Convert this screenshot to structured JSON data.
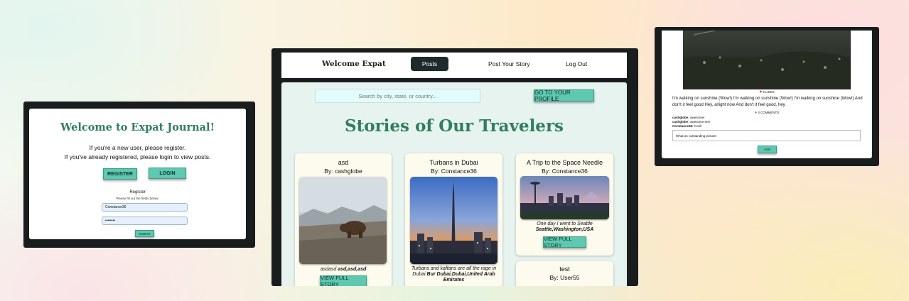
{
  "login": {
    "title": "Welcome to Expat Journal!",
    "line1": "If you're a new user, please register.",
    "line2": "If you've already registered, please login to view posts.",
    "register_button": "Register",
    "login_button": "Login",
    "form_heading": "Register",
    "form_sub": "Please fill out the fields below:",
    "username_value": "Constance36",
    "password_value": "••••••••",
    "submit_button": "Submit"
  },
  "nav": {
    "brand": "Welcome Expat",
    "tab_posts": "Posts",
    "tab_post_story": "Post Your Story",
    "tab_logout": "Log Out"
  },
  "posts_page": {
    "search_placeholder": "Search by city, state, or country...",
    "profile_button": "Go to your profile",
    "heading": "Stories of Our Travelers",
    "view_full_story": "View full story",
    "cards": [
      {
        "title": "asd",
        "by": "By: cashglobe",
        "desc": "asdasd",
        "location": "asd,asd,asd"
      },
      {
        "title": "Turbans in Dubai",
        "by": "By: Constance36",
        "desc": "Turbans and kaftans are all the rage in Dubai",
        "location": "Bur Dubai,Dubai,United Arab Emirates"
      },
      {
        "title": "A Trip to the Space Needle",
        "by": "By: Constance36",
        "desc": "One day I went to Seattle",
        "location": "Seattle,Washington,USA"
      },
      {
        "title": "test",
        "by": "By: User55"
      }
    ]
  },
  "story_page": {
    "likes": "3 LIKES",
    "body": "I'm walking on sunshine (Wow!) I'm walking on sunshine (Wow!) I'm walking on sunshine (Wow!) And don't it feel good Hey, alright now And don't it feel good, hey",
    "comments_count": "3 COMMENTS",
    "comments": [
      {
        "user": "cashglobe:",
        "text": "awesome!"
      },
      {
        "user": "cashglobe:",
        "text": "awesome test"
      },
      {
        "user": "Constance36:",
        "text": "Cool!"
      }
    ],
    "comment_input_value": "What an outstanding picture!",
    "add_button": "Add"
  },
  "colors": {
    "accent": "#5ec8b0",
    "title_green": "#2f7e5f",
    "frame": "#1a1d1e",
    "panel_bg": "#e6f3ee",
    "card_bg": "#fdfbee",
    "heart": "#d7262c"
  }
}
